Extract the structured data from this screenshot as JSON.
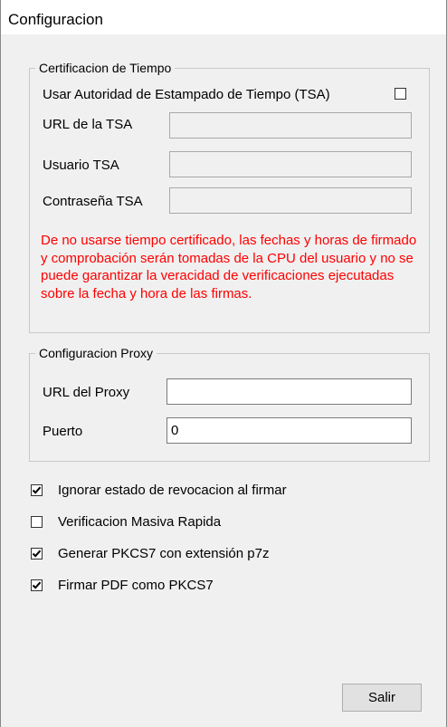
{
  "window": {
    "title": "Configuracion"
  },
  "tsa_group": {
    "legend": "Certificacion de Tiempo",
    "use_tsa_label": "Usar Autoridad de Estampado de Tiempo (TSA)",
    "use_tsa_checked": false,
    "url_label": "URL de la TSA",
    "url_value": "",
    "user_label": "Usuario TSA",
    "user_value": "",
    "password_label": "Contraseña TSA",
    "password_value": "",
    "warning": "De no usarse tiempo certificado, las fechas y horas de firmado y comprobación serán tomadas de la CPU del usuario y no se puede garantizar la veracidad de verificaciones ejecutadas sobre la fecha y hora de las firmas.",
    "warning_color": "#ff0000"
  },
  "proxy_group": {
    "legend": "Configuracion Proxy",
    "url_label": "URL del Proxy",
    "url_value": "",
    "port_label": "Puerto",
    "port_value": "0"
  },
  "options": [
    {
      "label": "Ignorar estado de revocacion al firmar",
      "checked": true
    },
    {
      "label": "Verificacion Masiva Rapida",
      "checked": false
    },
    {
      "label": "Generar PKCS7 con extensión p7z",
      "checked": true
    },
    {
      "label": "Firmar PDF como PKCS7",
      "checked": true
    }
  ],
  "buttons": {
    "exit_label": "Salir"
  }
}
